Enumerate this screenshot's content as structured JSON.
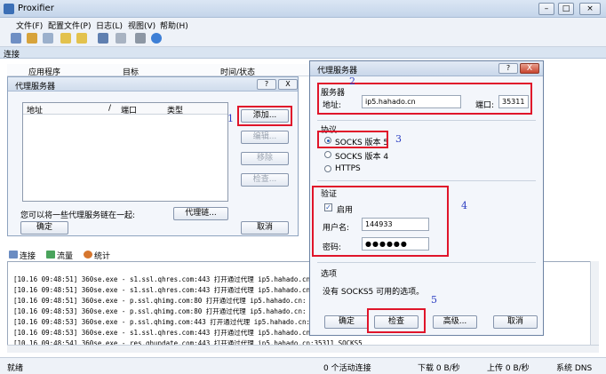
{
  "app": {
    "title": "Proxifier"
  },
  "menu": [
    "文件(F)",
    "配置文件(P)",
    "日志(L)",
    "视图(V)",
    "帮助(H)"
  ],
  "conn_bar": {
    "label": "连接"
  },
  "columns": [
    "应用程序",
    "目标",
    "时间/状态"
  ],
  "proxy_dialog": {
    "title": "代理服务器",
    "help": "?",
    "close": "X",
    "cols": [
      "地址",
      "/",
      "端口",
      "类型"
    ],
    "add": "添加...",
    "edit": "编辑...",
    "remove": "移除",
    "check": "检查...",
    "chain_hint": "您可以将一些代理服务链在一起:",
    "chain": "代理链...",
    "ok": "确定",
    "cancel": "取消"
  },
  "tabs": [
    "连接",
    "流量",
    "统计"
  ],
  "log_lines": [
    "[10.16 09:48:51] 360se.exe - s1.ssl.qhres.com:443 打开通过代理 ip5.hahado.cn:",
    "[10.16 09:48:51] 360se.exe - s1.ssl.qhres.com:443 打开通过代理 ip5.hahado.cn:",
    "[10.16 09:48:51] 360se.exe - p.ssl.qhimg.com:80 打开通过代理 ip5.hahado.cn:",
    "[10.16 09:48:53] 360se.exe - p.ssl.qhimg.com:80 打开通过代理 ip5.hahado.cn:",
    "[10.16 09:48:53] 360se.exe - p.ssl.qhimg.com:443 打开通过代理 ip5.hahado.cn:",
    "[10.16 09:48:53] 360se.exe - s1.ssl.qhres.com:443 打开通过代理 ip5.hahado.cn:",
    "[10.16 09:48:54] 360se.exe - res.qhupdate.com:443 打开通过代理 ip5.hahado.cn:35311 SOCKS5"
  ],
  "status": {
    "ready": "就绪",
    "active": "0 个活动连接",
    "down": "下载 0 B/秒",
    "up": "上传 0 B/秒",
    "dns": "系统 DNS"
  },
  "server_dialog": {
    "title": "代理服务器",
    "help": "?",
    "close": "X",
    "server_group": "服务器",
    "address_label": "地址:",
    "address_value": "ip5.hahado.cn",
    "port_label": "端口:",
    "port_value": "35311",
    "protocol_group": "协议",
    "protocols": [
      "SOCKS 版本 5",
      "SOCKS 版本 4",
      "HTTPS"
    ],
    "auth_group": "验证",
    "enable": "启用",
    "username_label": "用户名:",
    "username_value": "144933",
    "password_label": "密码:",
    "password_value": "●●●●●●",
    "options_group": "选项",
    "options_text": "没有 SOCKS5 可用的选项。",
    "ok": "确定",
    "check": "检查",
    "advanced": "高级...",
    "cancel": "取消"
  },
  "annotations": [
    "1",
    "2",
    "3",
    "4",
    "5"
  ]
}
